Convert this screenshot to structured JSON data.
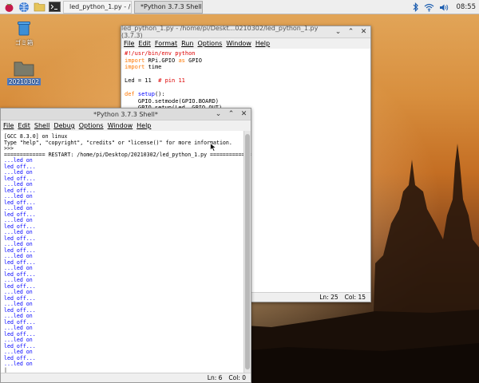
{
  "taskbar": {
    "tasks": [
      {
        "label": "led_python_1.py - /ho..."
      },
      {
        "label": "*Python 3.7.3 Shell*"
      }
    ],
    "clock": "08:55"
  },
  "desktop": {
    "icons": [
      {
        "label": "ゴミ箱"
      },
      {
        "label": "20210302"
      }
    ]
  },
  "editor": {
    "title": "led_python_1.py - /home/pi/Deskt...0210302/led_python_1.py (3.7.3)",
    "menu": [
      "File",
      "Edit",
      "Format",
      "Run",
      "Options",
      "Window",
      "Help"
    ],
    "lines": [
      [
        {
          "t": "#!/usr/bin/env python",
          "c": "cm"
        }
      ],
      [
        {
          "t": "import",
          "c": "kw"
        },
        {
          "t": " RPi.GPIO ",
          "c": ""
        },
        {
          "t": "as",
          "c": "kw"
        },
        {
          "t": " GPIO",
          "c": ""
        }
      ],
      [
        {
          "t": "import",
          "c": "kw"
        },
        {
          "t": " time",
          "c": ""
        }
      ],
      [
        {
          "t": "",
          "c": ""
        }
      ],
      [
        {
          "t": "Led = 11  ",
          "c": ""
        },
        {
          "t": "# pin 11",
          "c": "cm"
        }
      ],
      [
        {
          "t": "",
          "c": ""
        }
      ],
      [
        {
          "t": "def",
          "c": "kw"
        },
        {
          "t": " ",
          "c": ""
        },
        {
          "t": "setup",
          "c": "df"
        },
        {
          "t": "():",
          "c": ""
        }
      ],
      [
        {
          "t": "    GPIO.setmode(GPIO.BOARD)",
          "c": ""
        }
      ],
      [
        {
          "t": "    GPIO.setup(Led, GPIO.OUT)",
          "c": ""
        }
      ]
    ],
    "status": {
      "ln": "Ln: 25",
      "col": "Col: 15"
    }
  },
  "shell": {
    "title": "*Python 3.7.3 Shell*",
    "menu": [
      "File",
      "Edit",
      "Shell",
      "Debug",
      "Options",
      "Window",
      "Help"
    ],
    "header": [
      "[GCC 8.3.0] on linux",
      "Type \"help\", \"copyright\", \"credits\" or \"license()\" for more information.",
      ">>> ",
      "============= RESTART: /home/pi/Desktop/20210302/led_python_1.py ============="
    ],
    "output": [
      "...led on",
      "led off...",
      "...led on",
      "led off...",
      "...led on",
      "led off...",
      "...led on",
      "led off...",
      "...led on",
      "led off...",
      "...led on",
      "led off...",
      "...led on",
      "led off...",
      "...led on",
      "led off...",
      "...led on",
      "led off...",
      "...led on",
      "led off...",
      "...led on",
      "led off...",
      "...led on",
      "led off...",
      "...led on",
      "led off...",
      "...led on",
      "led off...",
      "...led on",
      "led off...",
      "...led on",
      "led off...",
      "...led on",
      "led off...",
      "...led on"
    ],
    "cursor": "|",
    "status": {
      "ln": "Ln: 6",
      "col": "Col: 0"
    }
  },
  "colors": {
    "keyword": "#ff7700",
    "comment": "#dd0000",
    "definition": "#0000ff",
    "stdout": "#0000ff"
  }
}
